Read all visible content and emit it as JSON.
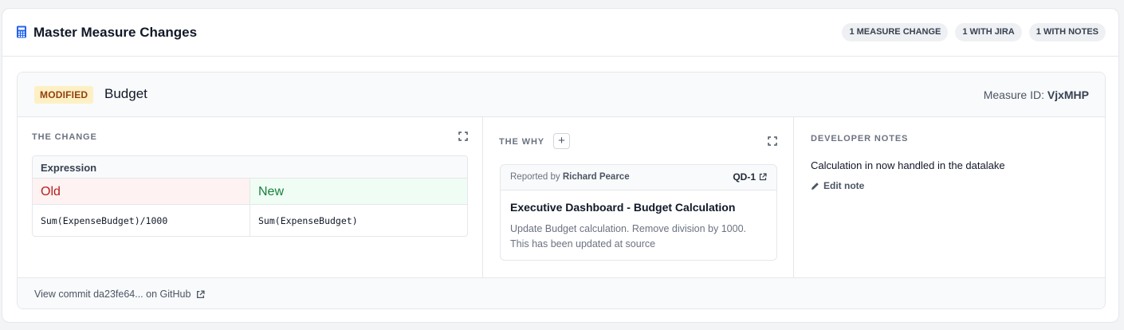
{
  "header": {
    "title": "Master Measure Changes",
    "icon": "calculator-icon",
    "pills": [
      "1 MEASURE CHANGE",
      "1 WITH JIRA",
      "1 WITH NOTES"
    ]
  },
  "measure": {
    "status": "MODIFIED",
    "name": "Budget",
    "id_label": "Measure ID:",
    "id_value": "VjxMHP"
  },
  "change": {
    "title": "THE CHANGE",
    "table_header": "Expression",
    "old_label": "Old",
    "new_label": "New",
    "old_value": "Sum(ExpenseBudget)/1000",
    "new_value": "Sum(ExpenseBudget)"
  },
  "why": {
    "title": "THE WHY",
    "add_label": "+",
    "reported_by_label": "Reported by",
    "reporter": "Richard Pearce",
    "jira_key": "QD-1",
    "jira_title": "Executive Dashboard - Budget Calculation",
    "jira_description": "Update Budget calculation. Remove division by 1000. This has been updated at source"
  },
  "notes": {
    "title": "DEVELOPER NOTES",
    "text": "Calculation in now handled in the datalake",
    "edit_label": "Edit note"
  },
  "footer": {
    "commit_link": "View commit da23fe64... on GitHub"
  },
  "colors": {
    "accent": "#2563eb",
    "modified_badge_bg": "#fdf0c4",
    "modified_badge_text": "#92400e",
    "old_bg": "#fef2f2",
    "old_text": "#b91c1c",
    "new_bg": "#f0fdf4",
    "new_text": "#15803d"
  }
}
